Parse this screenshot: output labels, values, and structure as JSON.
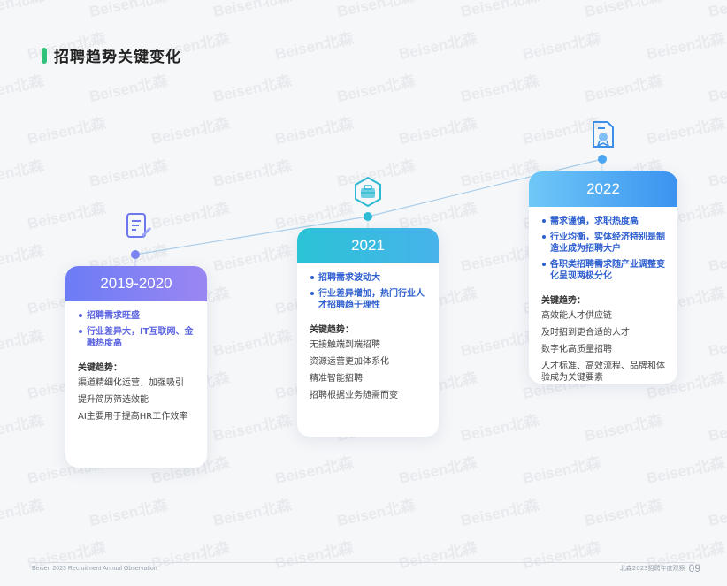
{
  "title": "招聘趋势关键变化",
  "watermark": "Beisen北森",
  "cards": [
    {
      "year": "2019-2020",
      "highlights": [
        "招聘需求旺盛",
        "行业差异大，IT互联网、金融热度高"
      ],
      "trend_title": "关键趋势：",
      "trends": [
        "渠道精细化运营，加强吸引",
        "提升简历筛选效能",
        "AI主要用于提高HR工作效率"
      ]
    },
    {
      "year": "2021",
      "highlights": [
        "招聘需求波动大",
        "行业差异增加，热门行业人才招聘趋于理性"
      ],
      "trend_title": "关键趋势：",
      "trends": [
        "无接触端到端招聘",
        "资源运营更加体系化",
        "精准智能招聘",
        "招聘根据业务随需而变"
      ]
    },
    {
      "year": "2022",
      "highlights": [
        "需求谨慎，求职热度高",
        "行业均衡，实体经济特别是制造业成为招聘大户",
        "各职类招聘需求随产业调整变化呈现两极分化"
      ],
      "trend_title": "关键趋势：",
      "trends": [
        "高效能人才供应链",
        "及时招到更合适的人才",
        "数字化高质量招聘",
        "人才标准、高效流程、品牌和体验成为关键要素"
      ]
    }
  ],
  "footer": {
    "left": "Beisen 2023 Recruitment Annual Observation",
    "right": "北森2023招聘年度观察",
    "page": "09"
  },
  "colors": {
    "accent_green": "#2fc07a",
    "card1_head": "#7b80f3",
    "card2_head": "#2bc3d6",
    "card3_head": "#4aa6f2",
    "timeline": "#9fc6e8"
  },
  "icons": [
    "document-edit-icon",
    "briefcase-icon",
    "certificate-icon"
  ]
}
